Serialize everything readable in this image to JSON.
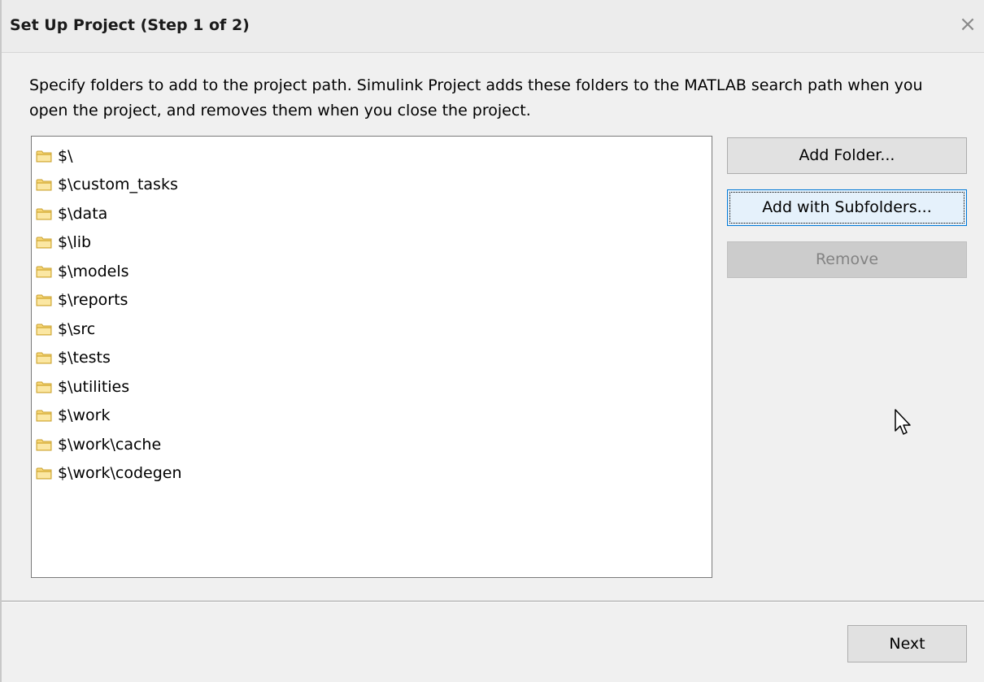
{
  "window": {
    "title": "Set Up Project (Step 1 of 2)",
    "close_glyph": "×"
  },
  "description": "Specify folders to add to the project path. Simulink Project adds these folders to the MATLAB search path when you open the project, and removes them when you close the project.",
  "folders": [
    "$\\",
    "$\\custom_tasks",
    "$\\data",
    "$\\lib",
    "$\\models",
    "$\\reports",
    "$\\src",
    "$\\tests",
    "$\\utilities",
    "$\\work",
    "$\\work\\cache",
    "$\\work\\codegen"
  ],
  "buttons": {
    "add_folder": "Add Folder...",
    "add_with_subfolders": "Add with Subfolders...",
    "remove": "Remove",
    "next": "Next"
  },
  "icons": {
    "folder": "folder-icon",
    "close": "close-icon",
    "cursor": "mouse-pointer-icon"
  },
  "colors": {
    "folder_fill": "#f8d775",
    "folder_stroke": "#c8a030",
    "focus_border": "#0078d7",
    "disabled_text": "#838383"
  }
}
